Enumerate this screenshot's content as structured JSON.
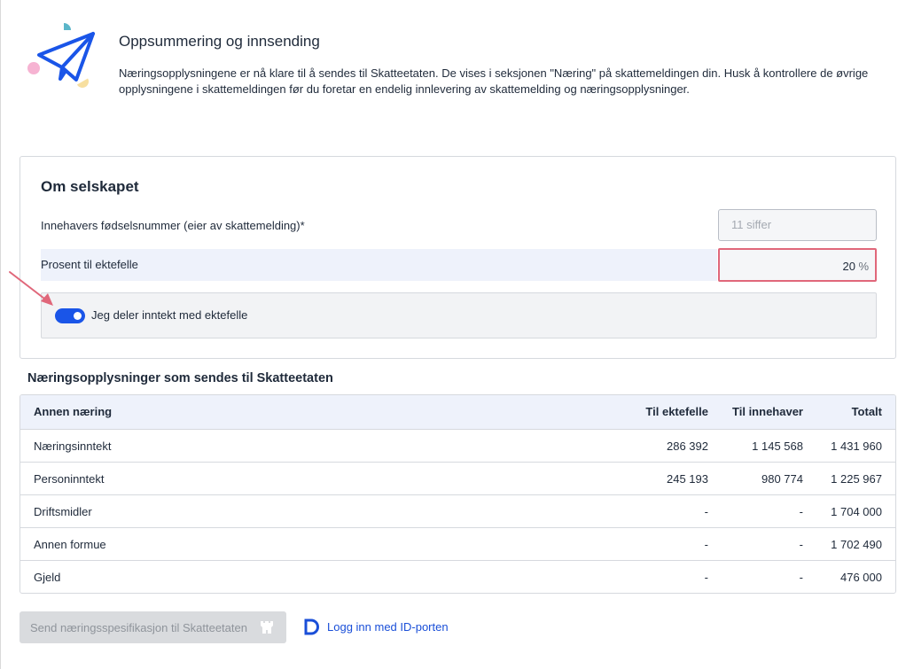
{
  "header": {
    "title": "Oppsummering og innsending",
    "description": "Næringsopplysningene er nå klare til å sendes til Skatteetaten. De vises i seksjonen \"Næring\" på skattemeldingen din. Husk å kontrollere de øvrige opplysningene i skattemeldingen før du foretar en endelig innlevering av skattemelding og næringsopplysninger."
  },
  "company": {
    "title": "Om selskapet",
    "owner_id_label": "Innehavers fødselsnummer (eier av skattemelding)*",
    "owner_id_placeholder": "11 siffer",
    "spouse_percent_label": "Prosent til ektefelle",
    "spouse_percent_value": "20",
    "spouse_percent_unit": "%",
    "share_income_label": "Jeg deler inntekt med ektefelle",
    "share_income_on": true
  },
  "table": {
    "title": "Næringsopplysninger som sendes til Skatteetaten",
    "columns": [
      "Annen næring",
      "Til ektefelle",
      "Til innehaver",
      "Totalt"
    ],
    "rows": [
      [
        "Næringsinntekt",
        "286 392",
        "1 145 568",
        "1 431 960"
      ],
      [
        "Personinntekt",
        "245 193",
        "980 774",
        "1 225 967"
      ],
      [
        "Driftsmidler",
        "-",
        "-",
        "1 704 000"
      ],
      [
        "Annen formue",
        "-",
        "-",
        "1 702 490"
      ],
      [
        "Gjeld",
        "-",
        "-",
        "476 000"
      ]
    ]
  },
  "footer": {
    "send_label": "Send næringsspesifikasjon til Skatteetaten",
    "login_label": "Logg inn med ID-porten"
  },
  "colors": {
    "accent_blue": "#1a55e8",
    "highlight_red": "#e0677a",
    "header_row_bg": "#eef2fb"
  }
}
